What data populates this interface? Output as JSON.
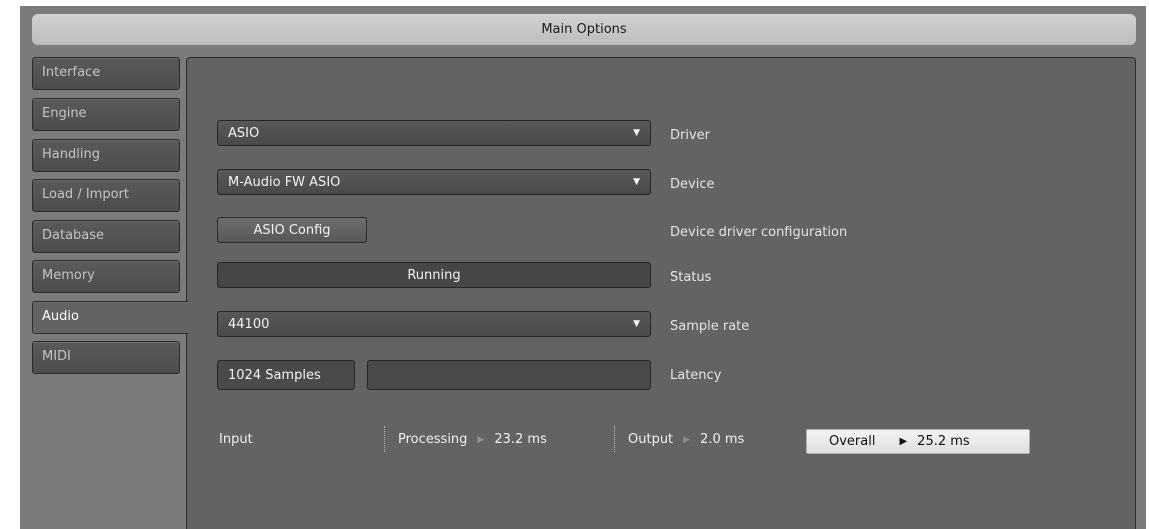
{
  "window": {
    "title": "Main Options"
  },
  "tabs": [
    {
      "label": "Interface",
      "active": false
    },
    {
      "label": "Engine",
      "active": false
    },
    {
      "label": "Handling",
      "active": false
    },
    {
      "label": "Load / Import",
      "active": false
    },
    {
      "label": "Database",
      "active": false
    },
    {
      "label": "Memory",
      "active": false
    },
    {
      "label": "Audio",
      "active": true
    },
    {
      "label": "MIDI",
      "active": false
    }
  ],
  "audio": {
    "driver": {
      "value": "ASIO",
      "label": "Driver"
    },
    "device": {
      "value": "M-Audio FW ASIO",
      "label": "Device"
    },
    "config": {
      "button_label": "ASIO Config",
      "label": "Device driver configuration"
    },
    "status": {
      "value": "Running",
      "label": "Status"
    },
    "sample_rate": {
      "value": "44100",
      "label": "Sample rate"
    },
    "latency": {
      "value": "1024 Samples",
      "label": "Latency",
      "slider_value": ""
    }
  },
  "latency_info": {
    "input_label": "Input",
    "processing_label": "Processing",
    "processing_value": "23.2 ms",
    "output_label": "Output",
    "output_value": "2.0 ms",
    "overall_label": "Overall",
    "overall_value": "25.2 ms"
  },
  "icons": {
    "dropdown": "chevron-down-icon",
    "arrow": "play-arrow-icon"
  },
  "colors": {
    "panel": "#636363",
    "frame": "#7b7b7b",
    "title_bar": "#c8c8c8",
    "overall_bg": "#e8e8e8"
  }
}
